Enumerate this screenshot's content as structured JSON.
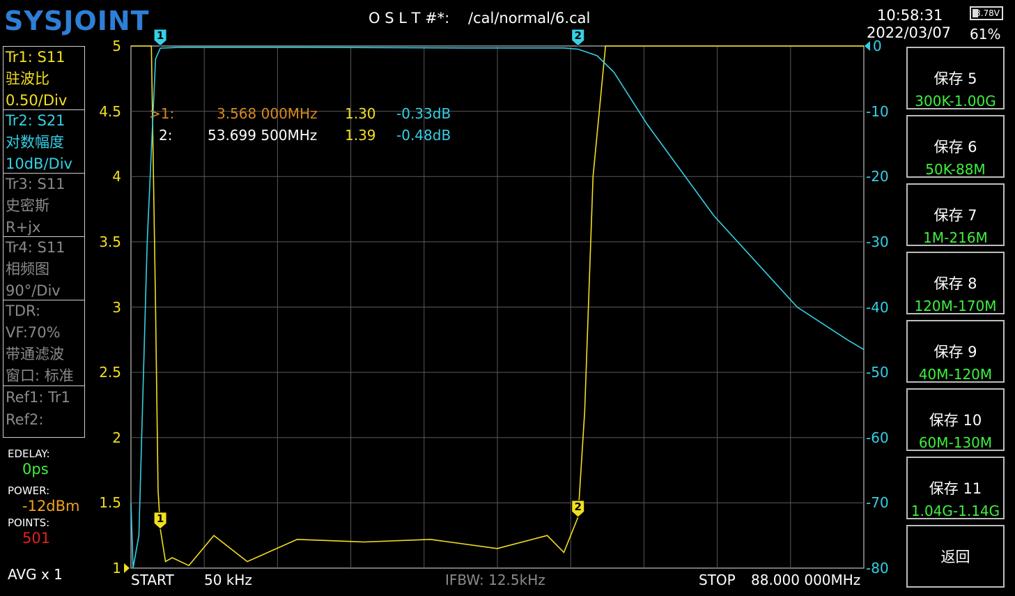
{
  "header": {
    "brand": "SYSJOINT",
    "cal_label": "O S L T #*:",
    "cal_file": "/cal/normal/6.cal",
    "time": "10:58:31",
    "date": "2022/03/07",
    "battery_voltage": "3.78V",
    "battery_percent": "61%"
  },
  "traces": [
    {
      "line1": "Tr1:   S11",
      "line2": "驻波比",
      "line3": "0.50/Div",
      "color": "#f2e01f"
    },
    {
      "line1": "Tr2:   S21",
      "line2": "对数幅度",
      "line3": "10dB/Div",
      "color": "#35d0e6"
    },
    {
      "line1": "Tr3:   S11",
      "line2": "史密斯",
      "line3": "R+jx",
      "color": "#8a8a8a"
    },
    {
      "line1": "Tr4:   S11",
      "line2": "相频图",
      "line3": "90°/Div",
      "color": "#8a8a8a"
    }
  ],
  "tdr": {
    "line1": "TDR:",
    "line2": "VF:70%",
    "line3": "带通滤波",
    "line4": "窗口: 标准"
  },
  "refs": {
    "line1": "Ref1:  Tr1",
    "line2": "Ref2:"
  },
  "settings": {
    "edelay_label": "EDELAY:",
    "edelay_value": "0ps",
    "power_label": "POWER:",
    "power_value": "-12dBm",
    "points_label": "POINTS:",
    "points_value": "501",
    "avg": "AVG x 1"
  },
  "left_axis": [
    "5",
    "4.5",
    "4",
    "3.5",
    "3",
    "2.5",
    "2",
    "1.5",
    "1"
  ],
  "right_axis": [
    "0",
    "-10",
    "-20",
    "-30",
    "-40",
    "-50",
    "-60",
    "-70",
    "-80"
  ],
  "markers": [
    {
      "id": ">1:",
      "freq": "3.568 000MHz",
      "swr": "1.30",
      "db": "-0.33dB"
    },
    {
      "id": "2:",
      "freq": "53.699 500MHz",
      "swr": "1.39",
      "db": "-0.48dB"
    }
  ],
  "marker_flags": [
    "1",
    "2"
  ],
  "bottom": {
    "start_label": "START",
    "start_value": "50 kHz",
    "ifbw": "IFBW: 12.5kHz",
    "stop_label": "STOP",
    "stop_value": "88.000 000MHz"
  },
  "buttons": [
    {
      "title": "保存 5",
      "sub": "300K-1.00G"
    },
    {
      "title": "保存 6",
      "sub": "50K-88M"
    },
    {
      "title": "保存 7",
      "sub": "1M-216M"
    },
    {
      "title": "保存 8",
      "sub": "120M-170M"
    },
    {
      "title": "保存 9",
      "sub": "40M-120M"
    },
    {
      "title": "保存 10",
      "sub": "60M-130M"
    },
    {
      "title": "保存 11",
      "sub": "1.04G-1.14G"
    }
  ],
  "back_button": "返回",
  "chart_data": {
    "type": "line",
    "x_range_mhz": [
      0.05,
      88.0
    ],
    "series": [
      {
        "name": "Tr1: S11",
        "y_axis": "left",
        "ylim": [
          1,
          5
        ],
        "x": [
          0.05,
          1.5,
          2.5,
          3.0,
          3.3,
          3.568,
          4.2,
          5.0,
          7.0,
          10,
          14,
          20,
          28,
          36,
          44,
          50,
          52,
          53.7,
          54.5,
          55.5,
          57,
          88
        ],
        "values": [
          5,
          5,
          5,
          3.0,
          1.6,
          1.3,
          1.05,
          1.08,
          1.02,
          1.25,
          1.05,
          1.22,
          1.2,
          1.22,
          1.15,
          1.25,
          1.12,
          1.39,
          2.2,
          4.0,
          5,
          5
        ]
      },
      {
        "name": "Tr2: S21",
        "y_axis": "right",
        "ylim": [
          -80,
          0
        ],
        "x": [
          0.05,
          0.3,
          1.0,
          2.0,
          3.0,
          3.568,
          6,
          20,
          40,
          52,
          53.7,
          56,
          58,
          62,
          70,
          80,
          86,
          88
        ],
        "values": [
          -70,
          -80,
          -75,
          -30,
          -2,
          -0.33,
          -0.2,
          -0.2,
          -0.3,
          -0.3,
          -0.48,
          -1.5,
          -4,
          -12,
          -26,
          -40,
          -45,
          -46.5
        ]
      }
    ]
  }
}
